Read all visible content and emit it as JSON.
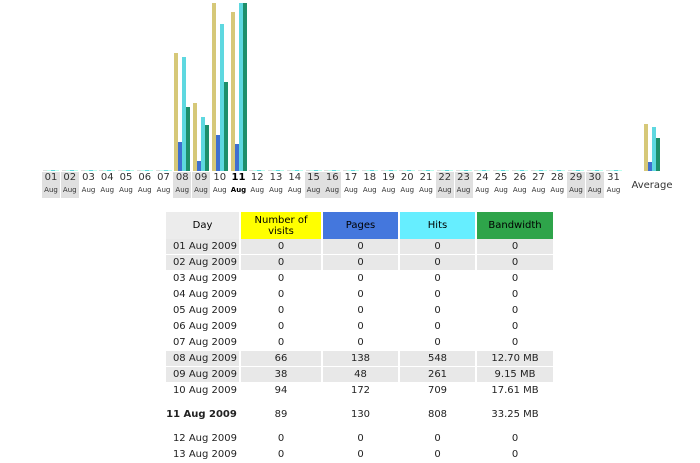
{
  "colors": {
    "visits": "#d6c878",
    "pages": "#3f6fcf",
    "hits": "#5ed8e0",
    "bandwidth": "#1e8f6a",
    "weekend": "#e0e0e0"
  },
  "chart_data": {
    "type": "bar",
    "series_names": [
      "Number of visits",
      "Pages",
      "Hits",
      "Bandwidth"
    ],
    "days": [
      {
        "d": "01",
        "m": "Aug",
        "we": true,
        "v": 0,
        "p": 0,
        "h": 0,
        "b": 0
      },
      {
        "d": "02",
        "m": "Aug",
        "we": true,
        "v": 0,
        "p": 0,
        "h": 0,
        "b": 0
      },
      {
        "d": "03",
        "m": "Aug",
        "v": 0,
        "p": 0,
        "h": 0,
        "b": 0
      },
      {
        "d": "04",
        "m": "Aug",
        "v": 0,
        "p": 0,
        "h": 0,
        "b": 0
      },
      {
        "d": "05",
        "m": "Aug",
        "v": 0,
        "p": 0,
        "h": 0,
        "b": 0
      },
      {
        "d": "06",
        "m": "Aug",
        "v": 0,
        "p": 0,
        "h": 0,
        "b": 0
      },
      {
        "d": "07",
        "m": "Aug",
        "v": 0,
        "p": 0,
        "h": 0,
        "b": 0
      },
      {
        "d": "08",
        "m": "Aug",
        "we": true,
        "v": 66,
        "p": 138,
        "h": 548,
        "b": 12.7
      },
      {
        "d": "09",
        "m": "Aug",
        "we": true,
        "v": 38,
        "p": 48,
        "h": 261,
        "b": 9.15
      },
      {
        "d": "10",
        "m": "Aug",
        "v": 94,
        "p": 172,
        "h": 709,
        "b": 17.61
      },
      {
        "d": "11",
        "m": "Aug",
        "today": true,
        "v": 89,
        "p": 130,
        "h": 808,
        "b": 33.25
      },
      {
        "d": "12",
        "m": "Aug",
        "v": 0,
        "p": 0,
        "h": 0,
        "b": 0
      },
      {
        "d": "13",
        "m": "Aug",
        "v": 0,
        "p": 0,
        "h": 0,
        "b": 0
      },
      {
        "d": "14",
        "m": "Aug",
        "v": 0,
        "p": 0,
        "h": 0,
        "b": 0
      },
      {
        "d": "15",
        "m": "Aug",
        "we": true,
        "v": 0,
        "p": 0,
        "h": 0,
        "b": 0
      },
      {
        "d": "16",
        "m": "Aug",
        "we": true,
        "v": 0,
        "p": 0,
        "h": 0,
        "b": 0
      },
      {
        "d": "17",
        "m": "Aug",
        "v": 0,
        "p": 0,
        "h": 0,
        "b": 0
      },
      {
        "d": "18",
        "m": "Aug",
        "v": 0,
        "p": 0,
        "h": 0,
        "b": 0
      },
      {
        "d": "19",
        "m": "Aug",
        "v": 0,
        "p": 0,
        "h": 0,
        "b": 0
      },
      {
        "d": "20",
        "m": "Aug",
        "v": 0,
        "p": 0,
        "h": 0,
        "b": 0
      },
      {
        "d": "21",
        "m": "Aug",
        "v": 0,
        "p": 0,
        "h": 0,
        "b": 0
      },
      {
        "d": "22",
        "m": "Aug",
        "we": true,
        "v": 0,
        "p": 0,
        "h": 0,
        "b": 0
      },
      {
        "d": "23",
        "m": "Aug",
        "we": true,
        "v": 0,
        "p": 0,
        "h": 0,
        "b": 0
      },
      {
        "d": "24",
        "m": "Aug",
        "v": 0,
        "p": 0,
        "h": 0,
        "b": 0
      },
      {
        "d": "25",
        "m": "Aug",
        "v": 0,
        "p": 0,
        "h": 0,
        "b": 0
      },
      {
        "d": "26",
        "m": "Aug",
        "v": 0,
        "p": 0,
        "h": 0,
        "b": 0
      },
      {
        "d": "27",
        "m": "Aug",
        "v": 0,
        "p": 0,
        "h": 0,
        "b": 0
      },
      {
        "d": "28",
        "m": "Aug",
        "v": 0,
        "p": 0,
        "h": 0,
        "b": 0
      },
      {
        "d": "29",
        "m": "Aug",
        "we": true,
        "v": 0,
        "p": 0,
        "h": 0,
        "b": 0
      },
      {
        "d": "30",
        "m": "Aug",
        "we": true,
        "v": 0,
        "p": 0,
        "h": 0,
        "b": 0
      },
      {
        "d": "31",
        "m": "Aug",
        "v": 0,
        "p": 0,
        "h": 0,
        "b": 0
      }
    ],
    "average": {
      "label": "Average",
      "v": 26.1,
      "p": 44.4,
      "h": 211.5,
      "b": 6.61
    }
  },
  "table": {
    "headers": {
      "day": "Day",
      "visits": "Number of visits",
      "pages": "Pages",
      "hits": "Hits",
      "bandwidth": "Bandwidth"
    },
    "rows": [
      {
        "day": "01 Aug 2009",
        "v": "0",
        "p": "0",
        "h": "0",
        "b": "0",
        "we": true
      },
      {
        "day": "02 Aug 2009",
        "v": "0",
        "p": "0",
        "h": "0",
        "b": "0",
        "we": true
      },
      {
        "day": "03 Aug 2009",
        "v": "0",
        "p": "0",
        "h": "0",
        "b": "0"
      },
      {
        "day": "04 Aug 2009",
        "v": "0",
        "p": "0",
        "h": "0",
        "b": "0"
      },
      {
        "day": "05 Aug 2009",
        "v": "0",
        "p": "0",
        "h": "0",
        "b": "0"
      },
      {
        "day": "06 Aug 2009",
        "v": "0",
        "p": "0",
        "h": "0",
        "b": "0"
      },
      {
        "day": "07 Aug 2009",
        "v": "0",
        "p": "0",
        "h": "0",
        "b": "0"
      },
      {
        "day": "08 Aug 2009",
        "v": "66",
        "p": "138",
        "h": "548",
        "b": "12.70 MB",
        "we": true
      },
      {
        "day": "09 Aug 2009",
        "v": "38",
        "p": "48",
        "h": "261",
        "b": "9.15 MB",
        "we": true
      },
      {
        "day": "10 Aug 2009",
        "v": "94",
        "p": "172",
        "h": "709",
        "b": "17.61 MB"
      },
      {
        "day": "11 Aug 2009",
        "v": "89",
        "p": "130",
        "h": "808",
        "b": "33.25 MB",
        "today": true
      },
      {
        "day": "12 Aug 2009",
        "v": "0",
        "p": "0",
        "h": "0",
        "b": "0"
      },
      {
        "day": "13 Aug 2009",
        "v": "0",
        "p": "0",
        "h": "0",
        "b": "0"
      }
    ]
  }
}
